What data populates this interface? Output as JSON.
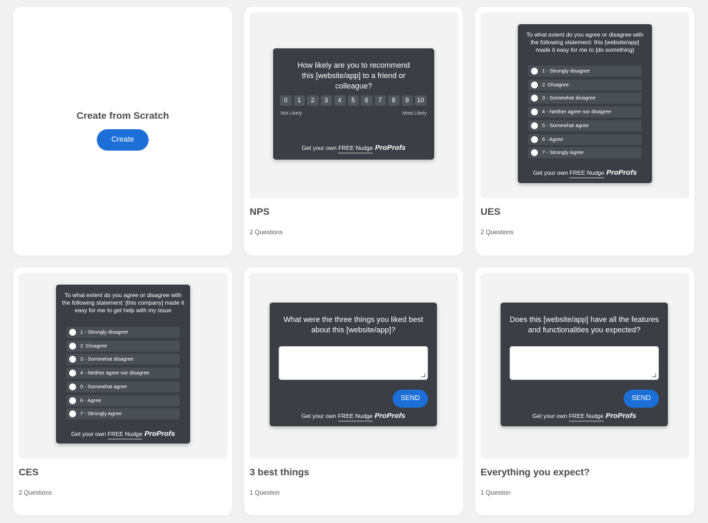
{
  "create_card": {
    "title": "Create from Scratch",
    "button": "Create"
  },
  "brand": {
    "prefix": "Get your own ",
    "free": "FREE Nudge",
    "name": "ProProfs"
  },
  "send_label": "SEND",
  "nps": {
    "title": "NPS",
    "count": "2 Questions",
    "question": "How likely are you to recommend this [website/app] to a friend or colleague?",
    "scale": [
      "0",
      "1",
      "2",
      "3",
      "4",
      "5",
      "6",
      "7",
      "8",
      "9",
      "10"
    ],
    "low_label": "Not Likely",
    "high_label": "Most Likely"
  },
  "ues": {
    "title": "UES",
    "count": "2 Questions",
    "question": "To what extent do you agree or disagree with the following statement: this [website/app] made it easy for me to [do something]",
    "options": [
      "1 - Strongly disagree",
      "2 -Disagree",
      "3 - Somewhat disagree",
      "4 - Neither agree nor disagree",
      "5 - Somewhat agree",
      "6 - Agree",
      "7 - Strongly Agree"
    ]
  },
  "ces": {
    "title": "CES",
    "count": "2 Questions",
    "question": "To what extent do you agree or disagree with the following statement: [this company] made it easy for me to get help with my issue",
    "options": [
      "1 - Strongly disagree",
      "2 -Disagree",
      "3 - Somewhat disagree",
      "4 - Neither agree nor disagree",
      "5 - Somewhat agree",
      "6 - Agree",
      "7 - Strongly Agree"
    ]
  },
  "best": {
    "title": "3 best things",
    "count": "1 Question",
    "question": "What were the three things you liked best about this [website/app]?"
  },
  "expect": {
    "title": "Everything you expect?",
    "count": "1 Question",
    "question": "Does this [website/app] have all the features and functionalities you expected?"
  }
}
